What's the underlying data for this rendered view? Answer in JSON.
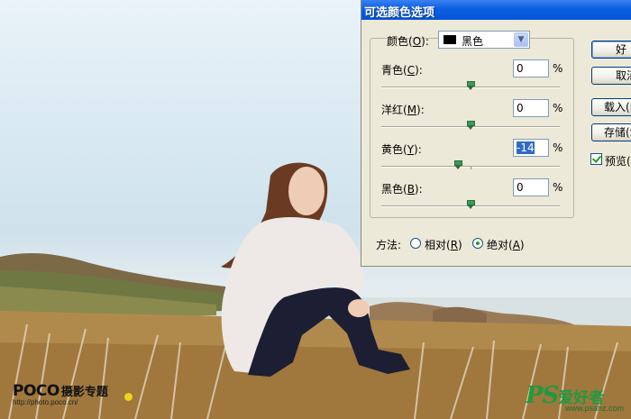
{
  "dialog": {
    "title": "可选颜色选项",
    "colors_label": "颜色(",
    "colors_key": "O",
    "colors_label_end": "):",
    "colors_value": "黑色",
    "sliders": [
      {
        "name": "cyan",
        "label_pre": "青色(",
        "key": "C",
        "label_post": "):",
        "value": "0",
        "unit": "%",
        "position": 0.5
      },
      {
        "name": "magenta",
        "label_pre": "洋红(",
        "key": "M",
        "label_post": "):",
        "value": "0",
        "unit": "%",
        "position": 0.5
      },
      {
        "name": "yellow",
        "label_pre": "黄色(",
        "key": "Y",
        "label_post": "):",
        "value": "-14",
        "unit": "%",
        "position": 0.43
      },
      {
        "name": "black",
        "label_pre": "黑色(",
        "key": "B",
        "label_post": "):",
        "value": "0",
        "unit": "%",
        "position": 0.5
      }
    ],
    "buttons": {
      "ok": "好",
      "cancel": "取消",
      "load": "载入(L",
      "save": "存储(S"
    },
    "preview": {
      "label": "预览(",
      "checked": true
    },
    "method": {
      "label": "方法:",
      "relative": {
        "label_pre": "相对(",
        "key": "R",
        "label_post": ")",
        "selected": false
      },
      "absolute": {
        "label_pre": "绝对(",
        "key": "A",
        "label_post": ")",
        "selected": true
      }
    }
  },
  "watermarks": {
    "left_brand": "POCO",
    "left_brand_cn": "摄影专题",
    "left_url": "http://photo.poco.cn/",
    "right_brand": "PS",
    "right_brand_cn": "爱好者",
    "right_url": "www.psahz.com"
  },
  "colors": {
    "titlebar": "#0454d6",
    "dialog_bg": "#ece9d8",
    "watermark_green": "#1f9a41",
    "selection": "#316ac5"
  }
}
